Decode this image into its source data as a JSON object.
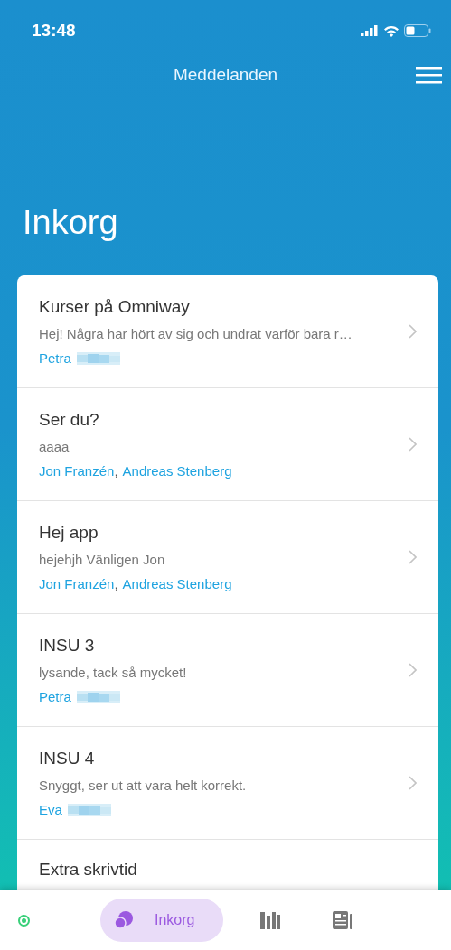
{
  "status_bar": {
    "time": "13:48"
  },
  "header": {
    "title": "Meddelanden"
  },
  "heading": "Inkorg",
  "separator": ",",
  "messages": [
    {
      "subject": "Kurser på Omniway",
      "preview": "Hej! Några har hört av sig och undrat varför bara r…",
      "senders": [
        {
          "name": "Petra",
          "redacted": true
        }
      ]
    },
    {
      "subject": "Ser du?",
      "preview": "aaaa",
      "senders": [
        {
          "name": "Jon Franzén",
          "redacted": false
        },
        {
          "name": "Andreas Stenberg",
          "redacted": false
        }
      ]
    },
    {
      "subject": "Hej app",
      "preview": "hejehjh Vänligen Jon",
      "senders": [
        {
          "name": "Jon Franzén",
          "redacted": false
        },
        {
          "name": "Andreas Stenberg",
          "redacted": false
        }
      ]
    },
    {
      "subject": "INSU 3",
      "preview": "lysande, tack så mycket!",
      "senders": [
        {
          "name": "Petra",
          "redacted": true
        }
      ]
    },
    {
      "subject": "INSU 4",
      "preview": "Snyggt, ser ut att vara helt korrekt.",
      "senders": [
        {
          "name": "Eva",
          "redacted": true
        }
      ]
    },
    {
      "subject": "Extra skrivtid"
    }
  ],
  "nav": {
    "online": true,
    "tabs": [
      {
        "kind": "inbox",
        "label": "Inkorg",
        "selected": true
      },
      {
        "kind": "library",
        "selected": false
      },
      {
        "kind": "news",
        "selected": false
      }
    ]
  }
}
